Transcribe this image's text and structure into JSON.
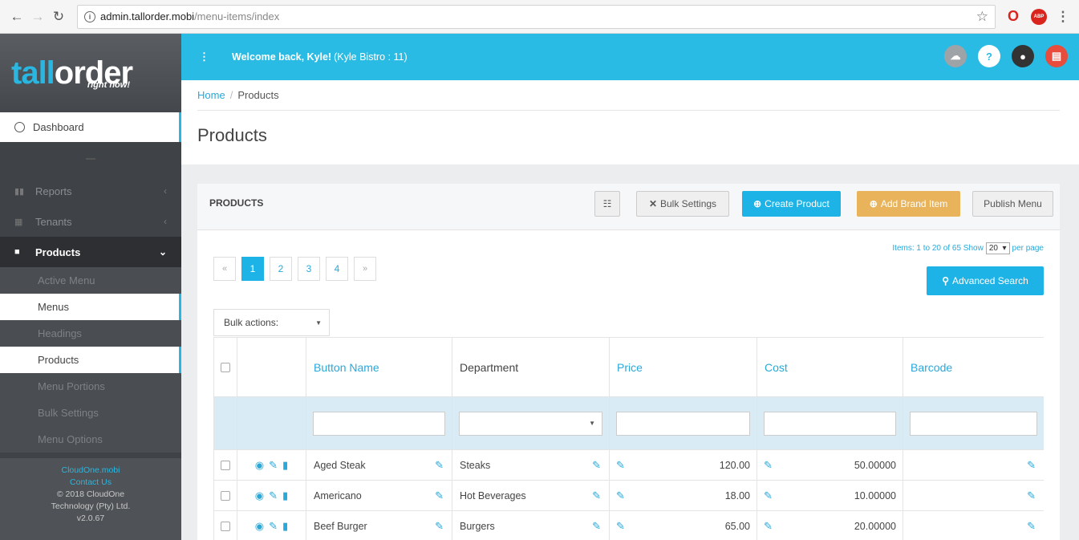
{
  "browser": {
    "url_host": "admin.tallorder.mobi",
    "url_path": "/menu-items/index"
  },
  "logo": {
    "tall": "tall",
    "order": "order",
    "tagline": "right now!"
  },
  "sidebar": {
    "dashboard": "Dashboard",
    "items": [
      {
        "label": "Reports"
      },
      {
        "label": "Tenants"
      },
      {
        "label": "Products"
      }
    ],
    "subitems": [
      {
        "label": "Active Menu"
      },
      {
        "label": "Menus"
      },
      {
        "label": "Headings"
      },
      {
        "label": "Products"
      },
      {
        "label": "Menu Portions"
      },
      {
        "label": "Bulk Settings"
      },
      {
        "label": "Menu Options"
      }
    ],
    "footer": {
      "link1": "CloudOne.mobi",
      "link2": "Contact Us",
      "copyright": "© 2018 CloudOne",
      "company": "Technology (Pty) Ltd.",
      "version": "v2.0.67"
    }
  },
  "topbar": {
    "welcome": "Welcome back, Kyle!",
    "tenant": "(Kyle Bistro : 11)"
  },
  "breadcrumb": {
    "home": "Home",
    "current": "Products"
  },
  "page": {
    "title": "Products"
  },
  "panel": {
    "title": "PRODUCTS",
    "bulk_settings": "Bulk Settings",
    "create_product": "Create Product",
    "add_brand_item": "Add Brand Item",
    "publish_menu": "Publish Menu",
    "items_info": "Items: 1 to 20 of 65 Show",
    "per_page_value": "20",
    "per_page_suffix": "per page",
    "advanced_search": "Advanced Search",
    "bulk_actions": "Bulk actions:"
  },
  "pagination": {
    "prev": "«",
    "pages": [
      "1",
      "2",
      "3",
      "4"
    ],
    "next": "»",
    "current": "1"
  },
  "table": {
    "columns": [
      "Button Name",
      "Department",
      "Price",
      "Cost",
      "Barcode"
    ],
    "rows": [
      {
        "name": "Aged Steak",
        "department": "Steaks",
        "price": "120.00",
        "cost": "50.00000"
      },
      {
        "name": "Americano",
        "department": "Hot Beverages",
        "price": "18.00",
        "cost": "10.00000"
      },
      {
        "name": "Beef Burger",
        "department": "Burgers",
        "price": "65.00",
        "cost": "20.00000"
      }
    ]
  }
}
